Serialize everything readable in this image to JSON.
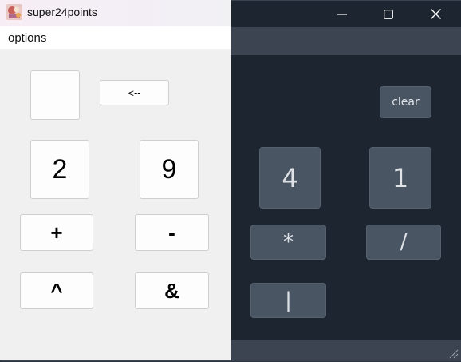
{
  "background_window": {
    "controls": {
      "minimize_icon": "minimize-icon",
      "maximize_icon": "maximize-icon",
      "close_icon": "close-icon"
    },
    "clear_label": "clear",
    "number_cards": [
      "4",
      "1"
    ],
    "operators": [
      "*",
      "/",
      "|"
    ]
  },
  "app": {
    "title": "super24points",
    "icon": "app-icon",
    "menu": {
      "options_label": "options"
    },
    "backspace_label": "<--",
    "selected_slot_value": "",
    "number_cards": [
      "2",
      "9"
    ],
    "operators": [
      "+",
      "-",
      "^",
      "&"
    ]
  },
  "colors": {
    "dark_bg": "#1c2530",
    "dark_bar": "#3b4450",
    "dark_button": "#4a5563",
    "light_bg": "#f0f0f0",
    "light_button": "#fdfdfd"
  }
}
